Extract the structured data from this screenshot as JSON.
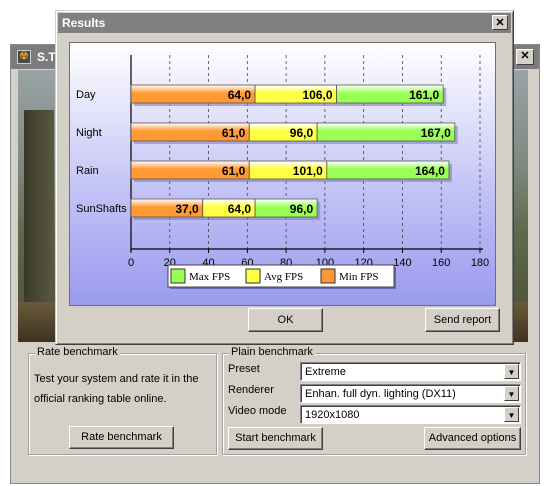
{
  "background_window": {
    "title": "S.T.",
    "close_glyph": "✕",
    "logo_glyph": "☢",
    "rate_group": {
      "label": "Rate benchmark",
      "description": "Test your system and rate it in the official ranking table online.",
      "button": "Rate benchmark"
    },
    "plain_group": {
      "label": "Plain benchmark",
      "preset_label": "Preset",
      "preset_value": "Extreme",
      "renderer_label": "Renderer",
      "renderer_value": "Enhan. full dyn. lighting (DX11)",
      "video_label": "Video mode",
      "video_value": "1920x1080",
      "start_button": "Start benchmark",
      "advanced_button": "Advanced options"
    }
  },
  "results_dialog": {
    "title": "Results",
    "close_glyph": "✕",
    "ok_button": "OK",
    "send_button": "Send report"
  },
  "chart_data": {
    "type": "bar",
    "orientation": "horizontal",
    "stacked": true,
    "categories": [
      "Day",
      "Night",
      "Rain",
      "SunShafts"
    ],
    "series": [
      {
        "name": "Min FPS",
        "values": [
          64.0,
          61.0,
          61.0,
          37.0
        ],
        "labels": [
          "64,0",
          "61,0",
          "61,0",
          "37,0"
        ],
        "color": "#ff9933"
      },
      {
        "name": "Avg FPS",
        "values": [
          106.0,
          96.0,
          101.0,
          64.0
        ],
        "labels": [
          "106,0",
          "96,0",
          "101,0",
          "64,0"
        ],
        "color": "#ffff44"
      },
      {
        "name": "Max FPS",
        "values": [
          161.0,
          167.0,
          164.0,
          96.0
        ],
        "labels": [
          "161,0",
          "167,0",
          "164,0",
          "96,0"
        ],
        "color": "#99ff55"
      }
    ],
    "xlim": [
      0,
      180
    ],
    "xticks": [
      0,
      20,
      40,
      60,
      80,
      100,
      120,
      140,
      160,
      180
    ],
    "legend_order": [
      "Max FPS",
      "Avg FPS",
      "Min FPS"
    ],
    "legend_position": "bottom",
    "grid": "vertical dashed"
  }
}
